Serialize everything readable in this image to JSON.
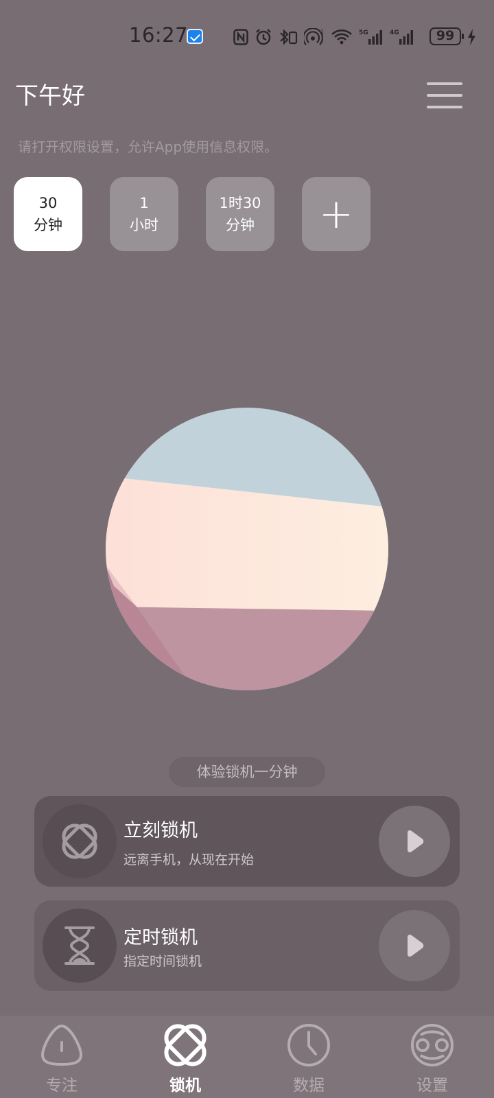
{
  "status_bar": {
    "time": "16:27",
    "battery": "99",
    "icons": [
      "message-notification-icon",
      "nfc-icon",
      "alarm-icon",
      "bluetooth-icon",
      "hotspot-icon",
      "wifi-icon",
      "signal-5g-icon",
      "signal-4g-icon",
      "battery-icon",
      "charging-icon"
    ]
  },
  "header": {
    "greeting": "下午好",
    "menu_icon": "hamburger-menu-icon",
    "permission_hint": "请打开权限设置，允许App使用信息权限。"
  },
  "durations": [
    {
      "line1": "30",
      "line2": "分钟",
      "selected": true
    },
    {
      "line1": "1",
      "line2": "小时",
      "selected": false
    },
    {
      "line1": "1时30",
      "line2": "分钟",
      "selected": false
    },
    {
      "line1": "+",
      "line2": "",
      "selected": false
    }
  ],
  "trial": {
    "label": "体验锁机一分钟"
  },
  "actions": {
    "lock_now": {
      "title": "立刻锁机",
      "subtitle": "远离手机，从现在开始",
      "icon": "interlock-icon"
    },
    "scheduled_lock": {
      "title": "定时锁机",
      "subtitle": "指定时间锁机",
      "icon": "hourglass-icon"
    }
  },
  "nav": {
    "items": [
      {
        "label": "专注",
        "icon": "focus-icon",
        "active": false
      },
      {
        "label": "锁机",
        "icon": "lock-icon",
        "active": true
      },
      {
        "label": "数据",
        "icon": "clock-icon",
        "active": false
      },
      {
        "label": "设置",
        "icon": "settings-icon",
        "active": false
      }
    ]
  },
  "colors": {
    "background": "#776d72",
    "chip_selected": "#ffffff",
    "chip": "#989296",
    "card_primary": "#5f555b",
    "card_secondary": "#6a6066",
    "nav_background": "#7f7479"
  }
}
